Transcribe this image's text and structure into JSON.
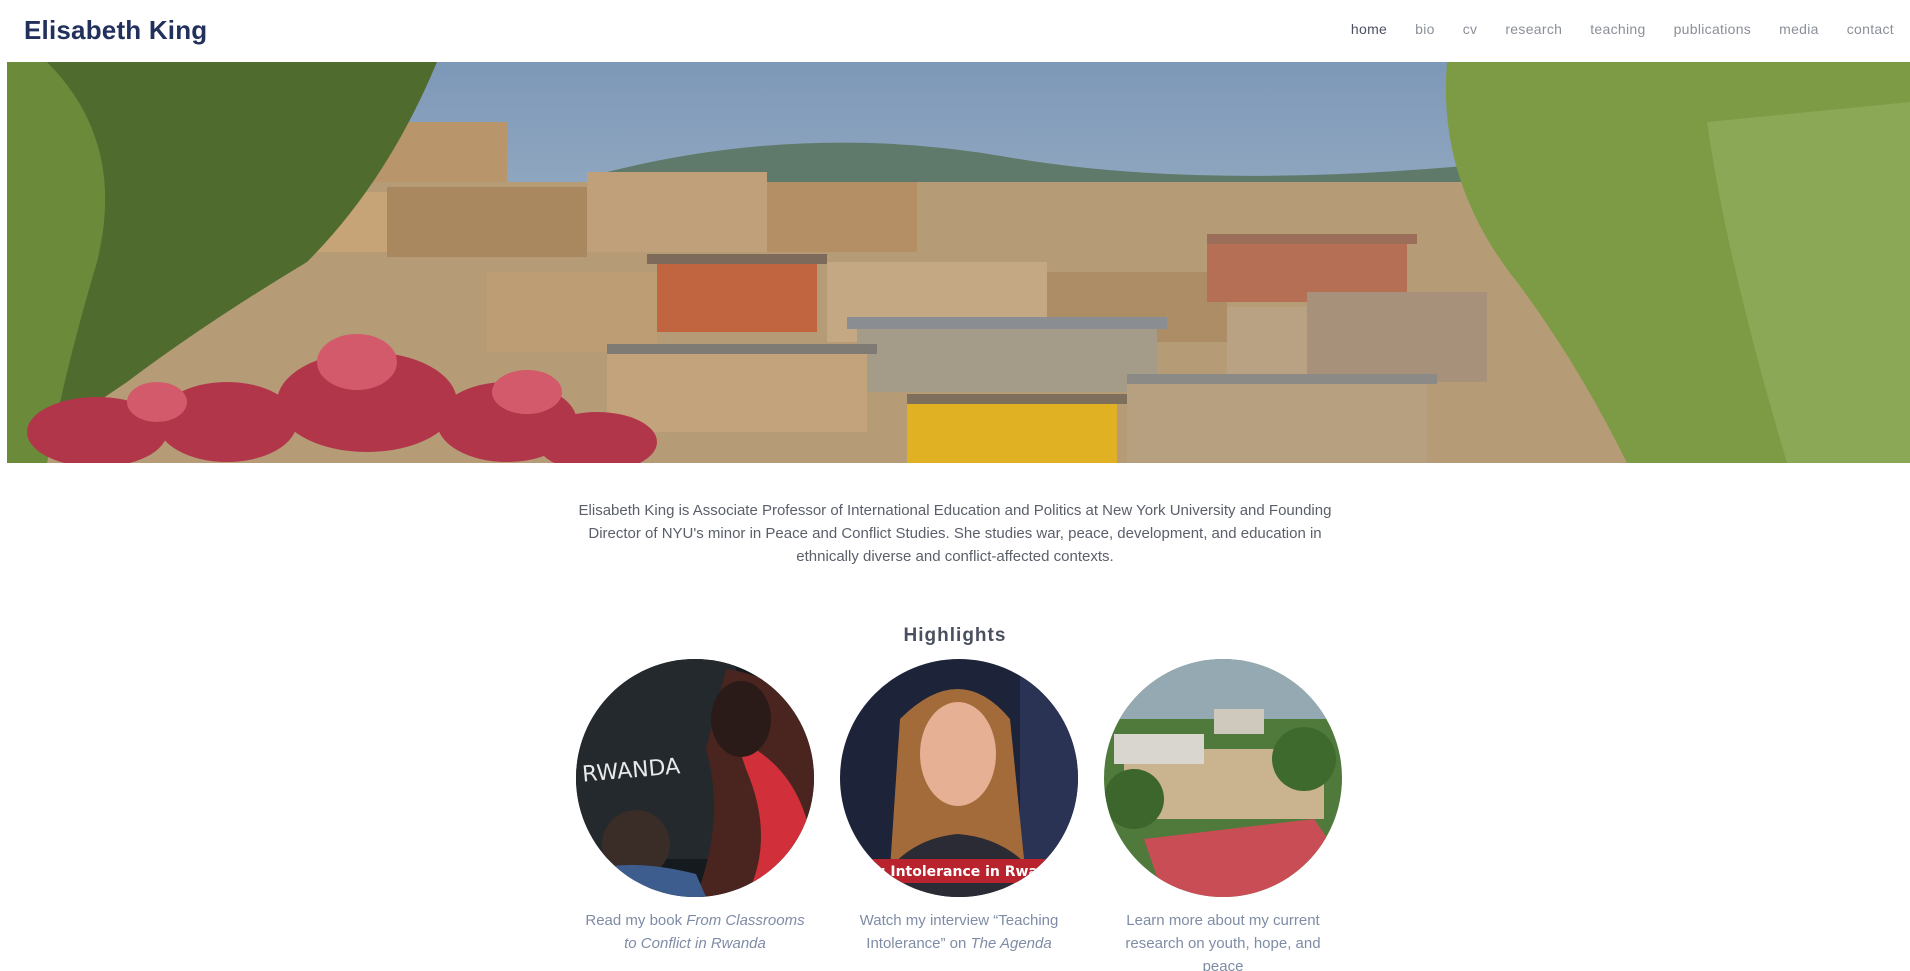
{
  "header": {
    "site_title": "Elisabeth King",
    "nav": [
      {
        "label": "home",
        "active": true
      },
      {
        "label": "bio",
        "active": false
      },
      {
        "label": "cv",
        "active": false
      },
      {
        "label": "research",
        "active": false
      },
      {
        "label": "teaching",
        "active": false
      },
      {
        "label": "publications",
        "active": false
      },
      {
        "label": "media",
        "active": false
      },
      {
        "label": "contact",
        "active": false
      }
    ]
  },
  "intro": {
    "text": "Elisabeth King is Associate Professor of International Education and Politics at New York University and Founding Director of NYU's minor in Peace and Conflict Studies. She studies war, peace, development, and education in ethnically diverse and conflict-affected contexts."
  },
  "highlights": {
    "title": "Highlights",
    "cards": [
      {
        "image_text": "RWANDA",
        "caption_prefix": "Read my book ",
        "caption_emphasis": "From Classrooms to Conflict in Rwanda",
        "caption_suffix": ""
      },
      {
        "image_text": "ting Intolerance in Rwa",
        "caption_prefix": "Watch my interview “Teaching Intolerance” on ",
        "caption_emphasis": "The Agenda",
        "caption_suffix": ""
      },
      {
        "image_text": "",
        "caption_prefix": "Learn more about my current research on youth, hope, and peace",
        "caption_emphasis": "",
        "caption_suffix": ""
      }
    ]
  },
  "colors": {
    "title": "#22305c",
    "nav": "#8a8f99",
    "nav_active": "#4a5060",
    "caption": "#7f8ca6"
  }
}
